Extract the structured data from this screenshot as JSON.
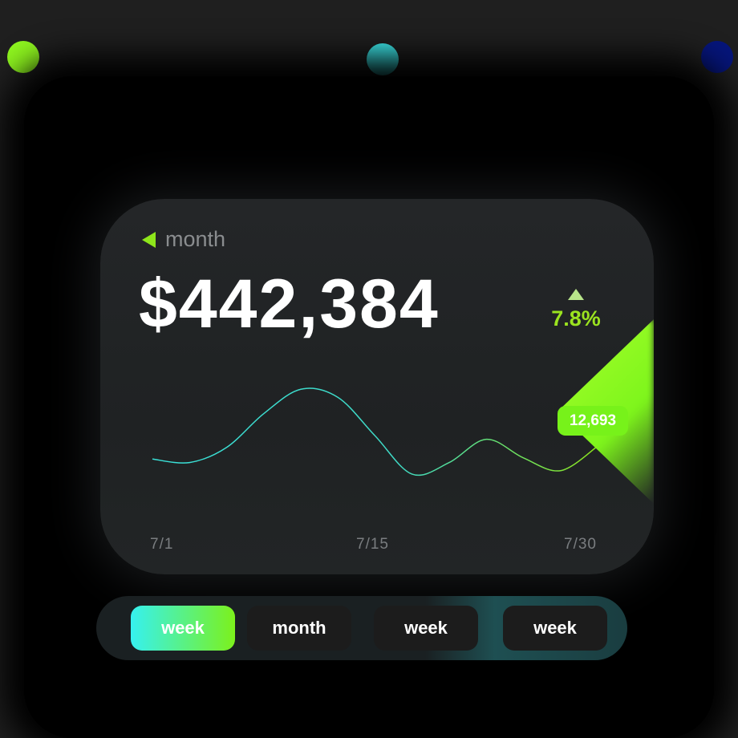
{
  "colors": {
    "dot_lime": "#8ef51f",
    "dot_cyan": "#3ff0f2",
    "dot_navy": "#06157a",
    "accent_green": "#77f21a",
    "line_start": "#39e0d8",
    "line_end": "#8ee61b"
  },
  "card": {
    "period_label": "month",
    "period_icon": "triangle-left-icon",
    "amount": "$442,384",
    "change_icon": "triangle-up-icon",
    "change_percent": "7.8%",
    "badge_value": "12,693"
  },
  "chart_data": {
    "type": "line",
    "x_tick_labels": [
      "7/1",
      "7/15",
      "7/30"
    ],
    "series": [
      {
        "values": [
          0.35,
          0.32,
          0.45,
          0.74,
          0.95,
          0.88,
          0.55,
          0.22,
          0.32,
          0.52,
          0.36,
          0.25,
          0.46
        ]
      }
    ],
    "grid": false,
    "highlight_value": "12,693"
  },
  "tabs": [
    {
      "label": "week",
      "active": true
    },
    {
      "label": "month",
      "active": false
    },
    {
      "label": "week",
      "active": false
    },
    {
      "label": "week",
      "active": false
    }
  ]
}
